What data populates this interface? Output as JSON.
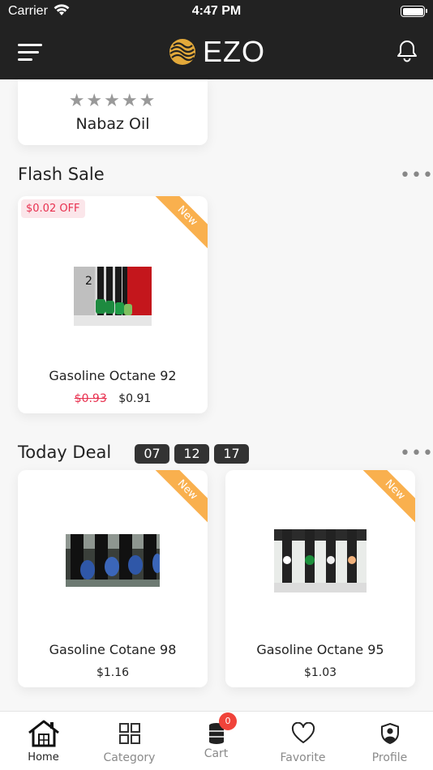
{
  "status_bar": {
    "carrier": "Carrier",
    "time": "4:47 PM"
  },
  "header": {
    "logo_text": "EZO"
  },
  "vendor_card": {
    "rating": 0,
    "max_rating": 5,
    "name": "Nabaz Oil"
  },
  "flash_sale": {
    "title": "Flash Sale",
    "more": "•••",
    "product": {
      "discount": "$0.02 OFF",
      "ribbon": "New",
      "name": "Gasoline Octane 92",
      "old_price": "$0.93",
      "price": "$0.91"
    }
  },
  "today_deal": {
    "title": "Today Deal",
    "more": "•••",
    "timer": [
      "07",
      "12",
      "17"
    ],
    "products": [
      {
        "ribbon": "New",
        "name": "Gasoline Cotane 98",
        "price": "$1.16"
      },
      {
        "ribbon": "New",
        "name": "Gasoline Octane 95",
        "price": "$1.03"
      }
    ]
  },
  "tabbar": {
    "tabs": [
      {
        "label": "Home",
        "icon": "home-icon"
      },
      {
        "label": "Category",
        "icon": "grid-icon"
      },
      {
        "label": "Cart",
        "icon": "cart-barrel-icon"
      },
      {
        "label": "Favorite",
        "icon": "heart-icon"
      },
      {
        "label": "Profile",
        "icon": "profile-shield-icon"
      }
    ],
    "cart_badge": "0"
  },
  "colors": {
    "bar": "#222222",
    "accent": "#f9b04e",
    "sale": "#e8304f",
    "badge": "#f0433a"
  }
}
